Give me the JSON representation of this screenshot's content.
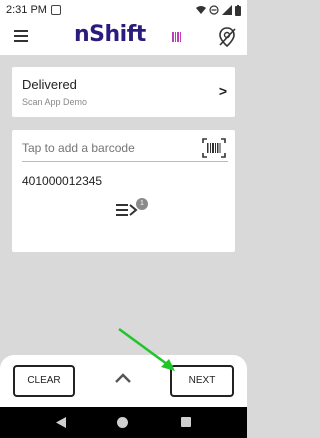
{
  "status_bar": {
    "time": "2:31 PM"
  },
  "header": {
    "logo_text": "nShift",
    "brand_color": "#2a1b7c",
    "accent_color": "#c43ab7"
  },
  "status_card": {
    "title": "Delivered",
    "subtitle": "Scan App Demo"
  },
  "barcode_card": {
    "placeholder": "Tap to add a barcode",
    "value": "401000012345",
    "badge_count": "1"
  },
  "actions": {
    "clear_label": "CLEAR",
    "next_label": "NEXT"
  },
  "colors": {
    "pointer_arrow": "#21c52a",
    "background": "#d9d9d9"
  }
}
